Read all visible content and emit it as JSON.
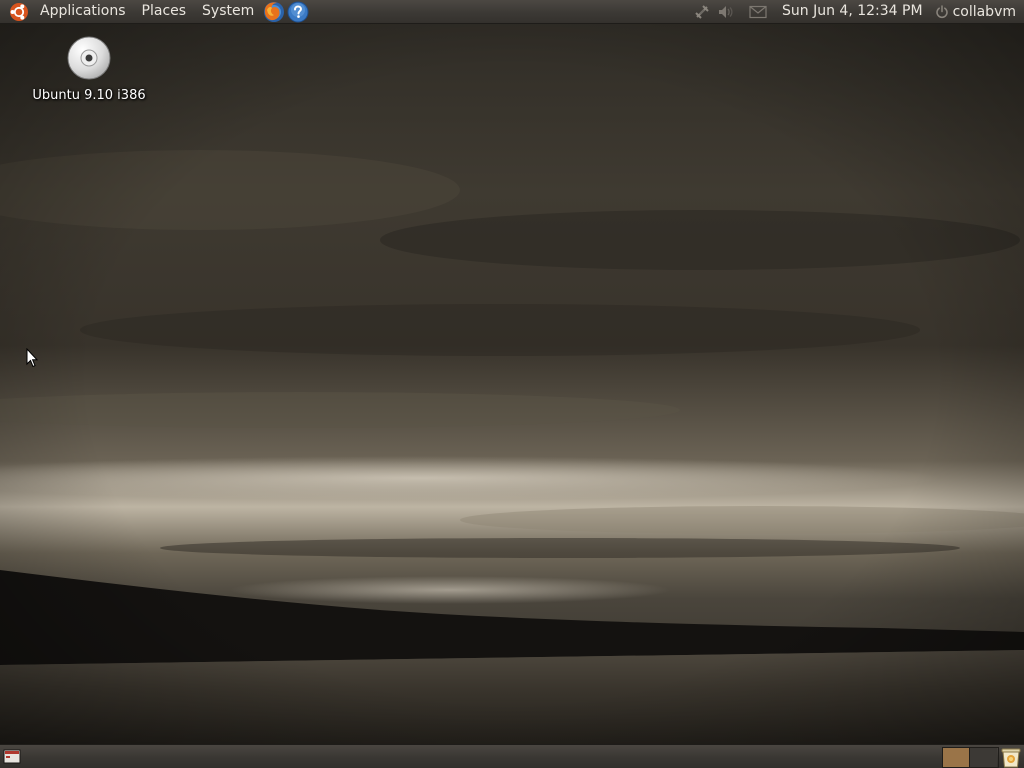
{
  "top_panel": {
    "menus": {
      "applications": "Applications",
      "places": "Places",
      "system": "System"
    },
    "launchers": [
      "firefox-icon",
      "help-icon"
    ],
    "tray": [
      "network-icon",
      "volume-icon",
      "mail-icon"
    ],
    "clock": "Sun Jun  4, 12:34 PM",
    "user": "collabvm"
  },
  "desktop": {
    "icons": [
      {
        "label": "Ubuntu 9.10 i386",
        "icon": "cd-icon"
      }
    ]
  },
  "bottom_panel": {
    "workspaces": 2,
    "active_workspace": 1
  },
  "colors": {
    "panel": "#3c3935",
    "active_workspace": "#9a7448",
    "panel_text": "#e9e5de"
  }
}
